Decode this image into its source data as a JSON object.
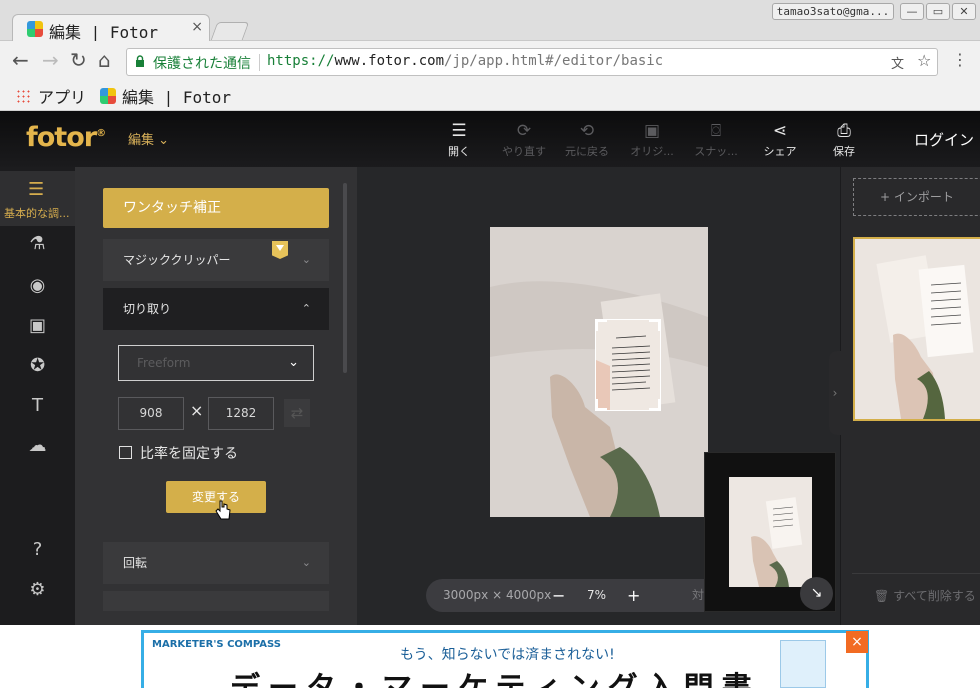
{
  "browser": {
    "tab_title": "編集 | Fotor",
    "tab_close": "×",
    "profile": "tamao3sato@gma...",
    "secure_label": "保護された通信",
    "url_scheme": "https://",
    "url_host": "www.fotor.com",
    "url_path": "/jp/app.html#/editor/basic",
    "bookmarks": {
      "apps": "アプリ",
      "fotor": "編集 | Fotor"
    }
  },
  "app": {
    "logo": "fotor",
    "logo_mark": "®",
    "menu_label": "編集",
    "toolbar": {
      "open": "開く",
      "redo": "やり直す",
      "undo": "元に戻る",
      "original": "オリジ...",
      "snapshot": "スナッ...",
      "share": "シェア",
      "save": "保存"
    },
    "login": "ログイン"
  },
  "leftbar": {
    "selected_label": "基本的な調..."
  },
  "panel": {
    "auto_fix": "ワンタッチ補正",
    "magic_clipper": "マジッククリッパー",
    "crop": "切り取り",
    "crop_mode": "Freeform",
    "width": "908",
    "height": "1282",
    "times": "×",
    "lock_ratio": "比率を固定する",
    "apply": "変更する",
    "rotate": "回転"
  },
  "canvas": {
    "size": "3000px × 4000px",
    "zoom": "7%",
    "compare": "対比",
    "minus": "−",
    "plus": "+"
  },
  "right": {
    "import": "インポート",
    "delete_all": "すべて削除する"
  },
  "ad": {
    "brand": "MARKETER'S COMPASS",
    "headline": "もう、知らないでは済まされない!",
    "big": "データ・マーケティング入門書",
    "close": "×"
  },
  "colors": {
    "accent": "#d4af4a",
    "panel": "#323234",
    "app_bg": "#262729"
  }
}
